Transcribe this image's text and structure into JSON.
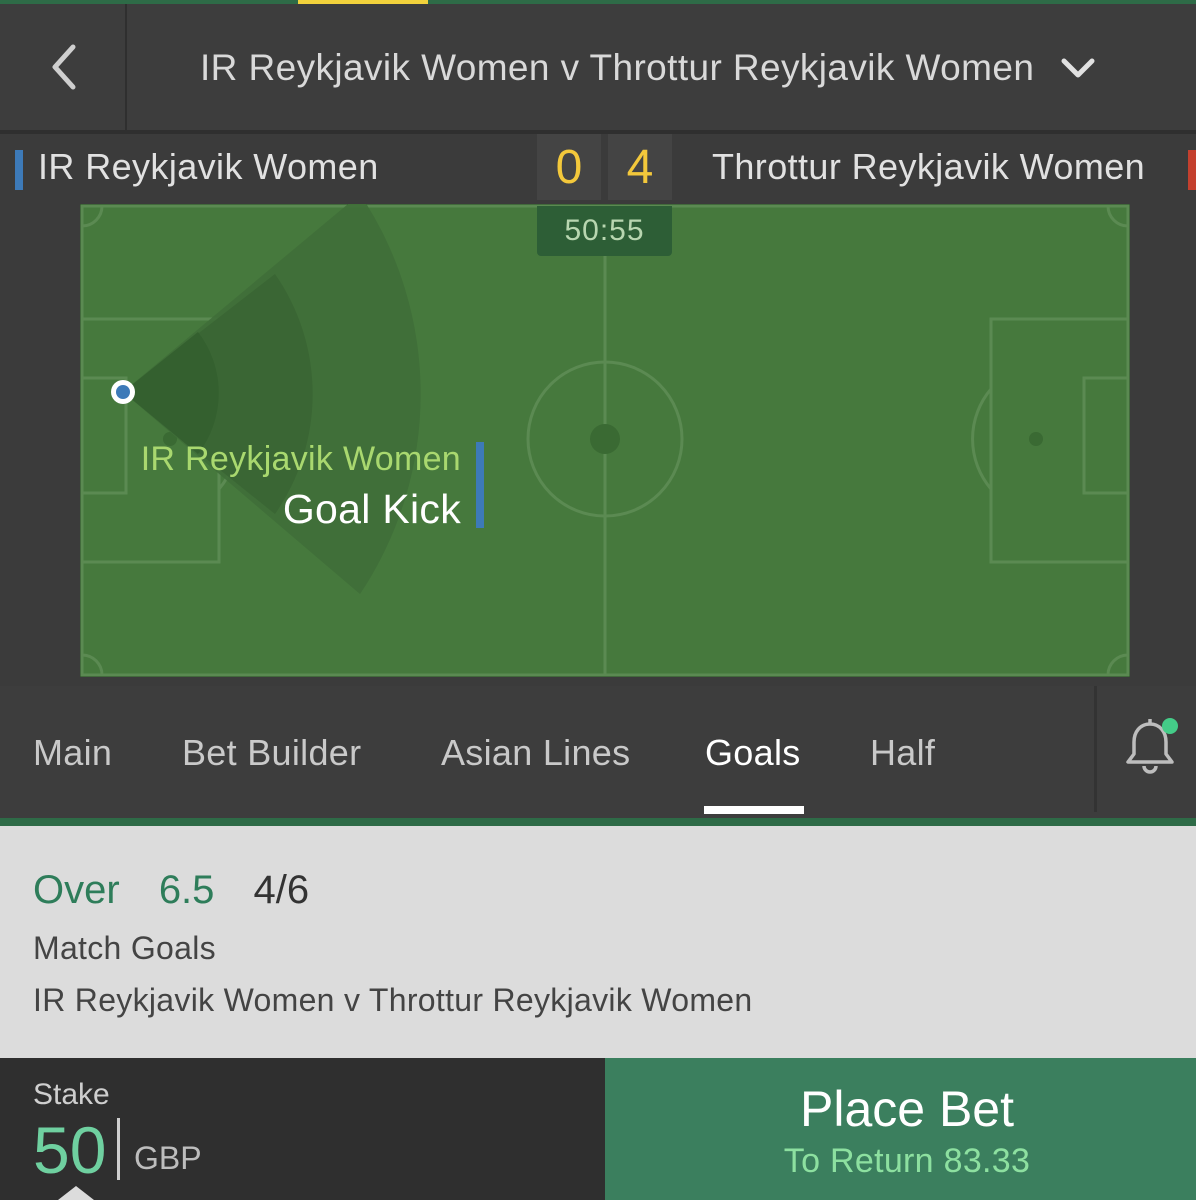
{
  "header": {
    "event_title": "IR Reykjavik Women v Throttur Reykjavik Women"
  },
  "scoreboard": {
    "home_team": "IR Reykjavik Women",
    "away_team": "Throttur Reykjavik Women",
    "home_score": "0",
    "away_score": "4",
    "clock": "50:55",
    "home_color": "#3d7ab8",
    "away_color": "#c4402e"
  },
  "pitch_event": {
    "team": "IR Reykjavik Women",
    "type": "Goal Kick"
  },
  "tabs": [
    {
      "label": "Main",
      "active": false
    },
    {
      "label": "Bet Builder",
      "active": false
    },
    {
      "label": "Asian Lines",
      "active": false
    },
    {
      "label": "Goals",
      "active": true
    },
    {
      "label": "Half",
      "active": false
    }
  ],
  "betslip": {
    "selection": "Over",
    "handicap": "6.5",
    "odds": "4/6",
    "market": "Match Goals",
    "event": "IR Reykjavik Women v Throttur Reykjavik Women"
  },
  "stake": {
    "label": "Stake",
    "value": "50",
    "currency": "GBP"
  },
  "place_bet": {
    "label": "Place Bet",
    "return_text": "To Return 83.33"
  },
  "colors": {
    "accent_green": "#3b7f5e",
    "pitch_green": "#46793d",
    "score_yellow": "#f3c83b"
  }
}
